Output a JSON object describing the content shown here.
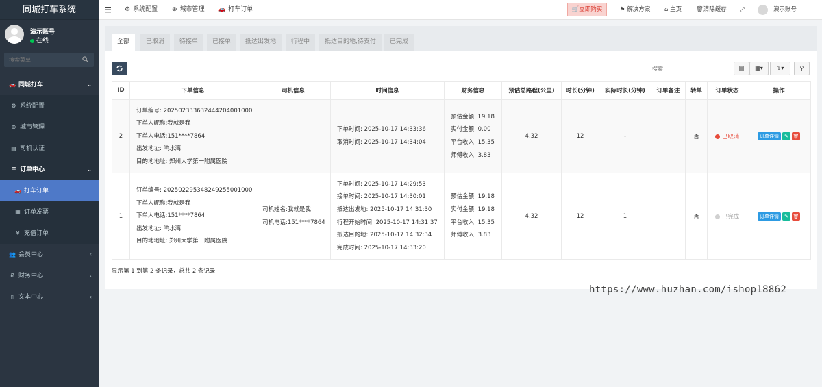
{
  "sidebar": {
    "brand": "同城打车系统",
    "user_name": "演示账号",
    "user_status": "在线",
    "search_placeholder": "搜索菜单",
    "menu": {
      "main": "同城打车",
      "system_config": "系统配置",
      "city_manage": "城市管理",
      "driver_auth": "司机认证",
      "order_center": "订单中心",
      "taxi_order": "打车订单",
      "order_invoice": "订单发票",
      "recharge_order": "充值订单",
      "member_center": "会员中心",
      "finance_center": "财务中心",
      "text_center": "文本中心"
    }
  },
  "topbar": {
    "tabs": [
      "系统配置",
      "城市管理",
      "打车订单"
    ],
    "buy_now": "立即购买",
    "solution": "解决方案",
    "home": "主页",
    "clear_cache": "清除缓存",
    "account": "演示账号"
  },
  "panel": {
    "tabs": [
      "全部",
      "已取消",
      "待接单",
      "已接单",
      "抵达出发地",
      "行程中",
      "抵达目的地,待支付",
      "已完成"
    ],
    "search_placeholder": "搜索",
    "columns": [
      "ID",
      "下单信息",
      "司机信息",
      "时间信息",
      "财务信息",
      "预估总路程(公里)",
      "时长(分钟)",
      "实际时长(分钟)",
      "订单备注",
      "转单",
      "订单状态",
      "操作"
    ],
    "rows": [
      {
        "id": "2",
        "order_info": [
          "订单编号: 202502333632444204001000",
          "下单人昵称:我就是我",
          "下单人电话:151****7864",
          "出发地址: 响水湾",
          "目的地地址: 郑州大学第一附属医院"
        ],
        "driver_info": [],
        "time_info": [
          "下单时间: 2025-10-17 14:33:36",
          "取消时间: 2025-10-17 14:34:04"
        ],
        "finance_info": [
          "预估金额: 19.18",
          "实付金额: 0.00",
          "平台收入: 15.35",
          "师傅收入: 3.83"
        ],
        "distance": "4.32",
        "duration": "12",
        "actual_duration": "-",
        "remark": "",
        "transfer": "否",
        "status": "已取消"
      },
      {
        "id": "1",
        "order_info": [
          "订单编号: 202502295348249255001000",
          "下单人昵称:我就是我",
          "下单人电话:151****7864",
          "出发地址: 响水湾",
          "目的地地址: 郑州大学第一附属医院"
        ],
        "driver_info": [
          "司机姓名:我就是我",
          "司机电话:151****7864"
        ],
        "time_info": [
          "下单时间: 2025-10-17 14:29:53",
          "接单时间: 2025-10-17 14:30:01",
          "抵达出发地: 2025-10-17 14:31:30",
          "行程开始时间: 2025-10-17 14:31:37",
          "抵达目的地: 2025-10-17 14:32:34",
          "完成时间: 2025-10-17 14:33:20"
        ],
        "finance_info": [
          "预估金额: 19.18",
          "实付金额: 19.18",
          "平台收入: 15.35",
          "师傅收入: 3.83"
        ],
        "distance": "4.32",
        "duration": "12",
        "actual_duration": "1",
        "remark": "",
        "transfer": "否",
        "status": "已完成"
      }
    ],
    "action_detail": "订单详情",
    "footer": "显示第 1 到第 2 条记录，总共 2 条记录"
  },
  "watermark": "https://www.huzhan.com/ishop18862",
  "colors": {
    "sidebar_bg": "#2b3541",
    "active_item": "#4e79c8",
    "cancel": "#e74c3c",
    "done": "#aaaaaa",
    "detail_btn": "#2d9be3"
  }
}
